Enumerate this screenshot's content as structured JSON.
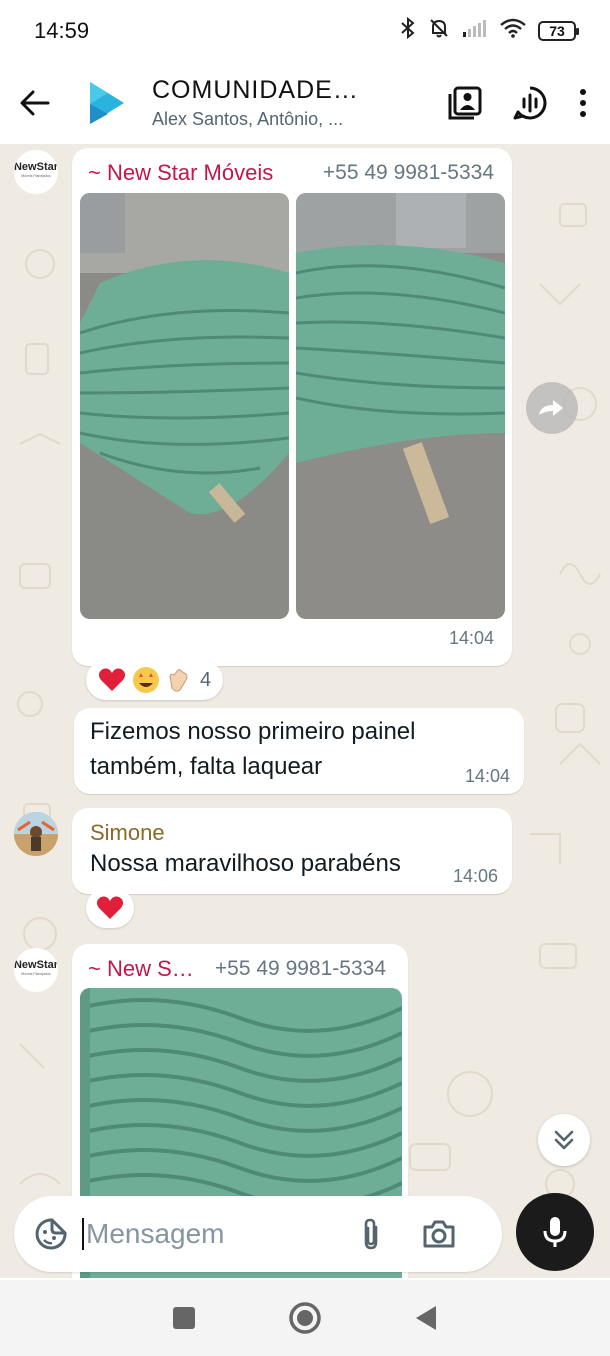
{
  "status_bar": {
    "time": "14:59",
    "battery": "73"
  },
  "header": {
    "title": "COMUNIDADE…",
    "members": "Alex Santos, Antônio, ..."
  },
  "messages": {
    "m1": {
      "sender": "~ New Star Móveis",
      "phone": "+55 49 9981-5334",
      "time": "14:04"
    },
    "reactions1": {
      "count": "4"
    },
    "m2": {
      "text_line1": "Fizemos nosso primeiro painel",
      "text_line2": "também, falta laquear",
      "time": "14:04"
    },
    "m3": {
      "sender": "Simone",
      "text": "Nossa maravilhoso parabéns",
      "time": "14:06"
    },
    "m4": {
      "sender": "~ New S…",
      "phone": "+55 49 9981-5334"
    }
  },
  "avatar_logo": {
    "brand": "NewStar",
    "tag": "Móveis Planejados",
    "city": "Xanxerê"
  },
  "composer": {
    "placeholder": "Mensagem"
  },
  "colors": {
    "sender_red": "#c0184a",
    "sender_gold": "#8a6a2b",
    "chat_bg": "#efeae2",
    "panel_green": "#6fae96",
    "mic_bg": "#1b1b1b"
  }
}
